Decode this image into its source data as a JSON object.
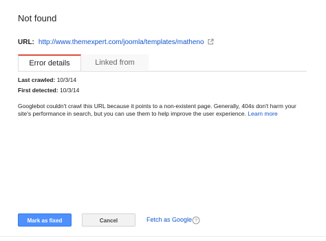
{
  "title": "Not found",
  "url": {
    "label": "URL:",
    "value": "http://www.themexpert.com/joomla/templates/matheno",
    "icon": "external-link-icon"
  },
  "tabs": [
    {
      "label": "Error details",
      "active": true
    },
    {
      "label": "Linked from",
      "active": false
    }
  ],
  "details": {
    "last_crawled_label": "Last crawled:",
    "last_crawled_value": "10/3/14",
    "first_detected_label": "First detected:",
    "first_detected_value": "10/3/14"
  },
  "description": {
    "text": "Googlebot couldn't crawl this URL because it points to a non-existent page. Generally, 404s don't harm your site's performance in search, but you can use them to help improve the user experience.",
    "link": "Learn more"
  },
  "actions": {
    "mark_fixed": "Mark as fixed",
    "cancel": "Cancel",
    "fetch_as_google": "Fetch as Google",
    "help_icon": "help-circle-icon"
  },
  "colors": {
    "primary_button": "#4d90fe",
    "link": "#1155cc",
    "active_tab_accent": "#dd4b39"
  }
}
